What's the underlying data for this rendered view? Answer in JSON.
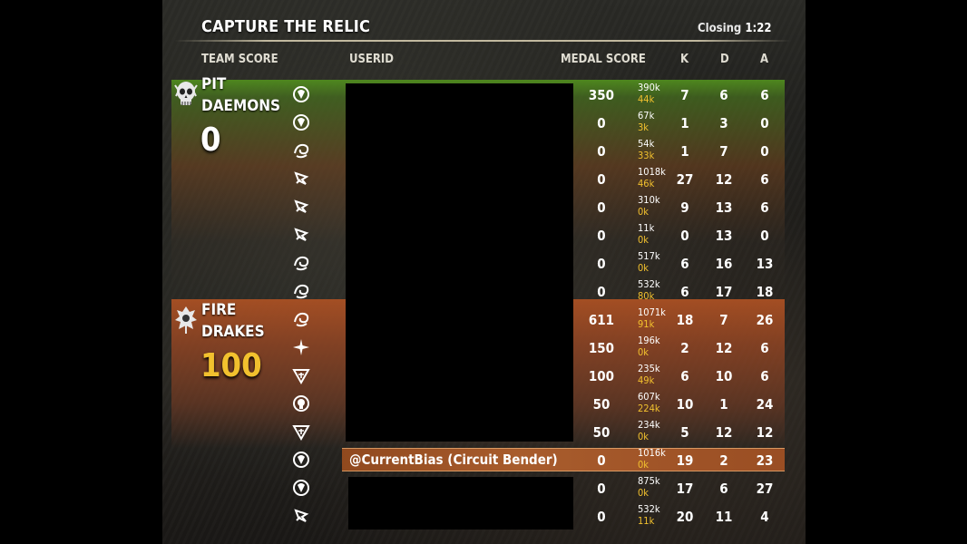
{
  "scoreboard": {
    "title": "CAPTURE THE RELIC",
    "closing_label": "Closing",
    "closing_time": "1:22",
    "headers": {
      "team_score": "TEAM SCORE",
      "userid": "USERID",
      "medal_score": "MEDAL SCORE",
      "k": "K",
      "d": "D",
      "a": "A"
    },
    "teams": [
      {
        "name_line1": "PIT",
        "name_line2": "DAEMONS",
        "score": "0",
        "emblem": "skull-emblem-icon",
        "color": "#4f8a1f",
        "players": [
          {
            "class": "nightblade-icon",
            "userid": "",
            "medal": "350",
            "damage": "390k",
            "healing": "44k",
            "k": "7",
            "d": "6",
            "a": "6"
          },
          {
            "class": "nightblade-icon",
            "userid": "",
            "medal": "0",
            "damage": "67k",
            "healing": "3k",
            "k": "1",
            "d": "3",
            "a": "0"
          },
          {
            "class": "dragonknight-icon",
            "userid": "",
            "medal": "0",
            "damage": "54k",
            "healing": "33k",
            "k": "1",
            "d": "7",
            "a": "0"
          },
          {
            "class": "warden-icon",
            "userid": "",
            "medal": "0",
            "damage": "1018k",
            "healing": "46k",
            "k": "27",
            "d": "12",
            "a": "6"
          },
          {
            "class": "warden-icon",
            "userid": "",
            "medal": "0",
            "damage": "310k",
            "healing": "0k",
            "k": "9",
            "d": "13",
            "a": "6"
          },
          {
            "class": "warden-icon",
            "userid": "",
            "medal": "0",
            "damage": "11k",
            "healing": "0k",
            "k": "0",
            "d": "13",
            "a": "0"
          },
          {
            "class": "dragonknight-icon",
            "userid": "",
            "medal": "0",
            "damage": "517k",
            "healing": "0k",
            "k": "6",
            "d": "16",
            "a": "13"
          },
          {
            "class": "dragonknight-icon",
            "userid": "",
            "medal": "0",
            "damage": "532k",
            "healing": "80k",
            "k": "6",
            "d": "17",
            "a": "18"
          }
        ]
      },
      {
        "name_line1": "FIRE",
        "name_line2": "DRAKES",
        "score": "100",
        "emblem": "dragon-emblem-icon",
        "color": "#a5532a",
        "score_color": "#f2c12e",
        "players": [
          {
            "class": "dragonknight-icon",
            "userid": "",
            "medal": "611",
            "damage": "1071k",
            "healing": "91k",
            "k": "18",
            "d": "7",
            "a": "26"
          },
          {
            "class": "sorcerer-icon",
            "userid": "",
            "medal": "150",
            "damage": "196k",
            "healing": "0k",
            "k": "2",
            "d": "12",
            "a": "6"
          },
          {
            "class": "templar-icon",
            "userid": "",
            "medal": "100",
            "damage": "235k",
            "healing": "49k",
            "k": "6",
            "d": "10",
            "a": "6"
          },
          {
            "class": "necromancer-icon",
            "userid": "",
            "medal": "50",
            "damage": "607k",
            "healing": "224k",
            "k": "10",
            "d": "1",
            "a": "24"
          },
          {
            "class": "templar-icon",
            "userid": "",
            "medal": "50",
            "damage": "234k",
            "healing": "0k",
            "k": "5",
            "d": "12",
            "a": "12"
          },
          {
            "class": "nightblade-icon",
            "userid": "@CurrentBias (Circuit Bender)",
            "medal": "0",
            "damage": "1016k",
            "healing": "0k",
            "k": "19",
            "d": "2",
            "a": "23",
            "is_self": true
          },
          {
            "class": "nightblade-icon",
            "userid": "",
            "medal": "0",
            "damage": "875k",
            "healing": "0k",
            "k": "17",
            "d": "6",
            "a": "27"
          },
          {
            "class": "warden-icon",
            "userid": "",
            "medal": "0",
            "damage": "532k",
            "healing": "11k",
            "k": "20",
            "d": "11",
            "a": "4"
          }
        ]
      }
    ]
  }
}
